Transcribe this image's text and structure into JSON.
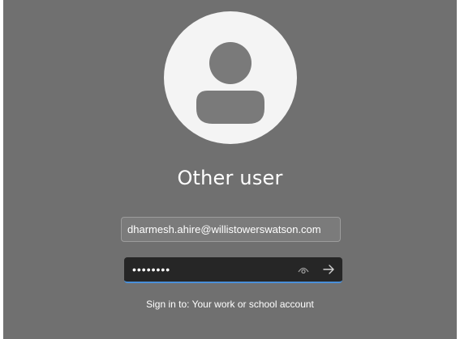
{
  "user": {
    "name": "Other user",
    "avatar_icon": "person-icon"
  },
  "email_field": {
    "value": "dharmesh.ahire@willistowerswatson.com"
  },
  "password_field": {
    "value": "••••••••",
    "reveal_icon": "eye-icon",
    "submit_icon": "arrow-right-icon"
  },
  "sign_in_info": {
    "text": "Sign in to: Your work or school account"
  },
  "colors": {
    "background": "#707070",
    "avatar_background": "#f4f4f4",
    "avatar_glyph": "#7a7a7a",
    "password_background": "#262626",
    "focus_accent": "#4a90d9"
  }
}
